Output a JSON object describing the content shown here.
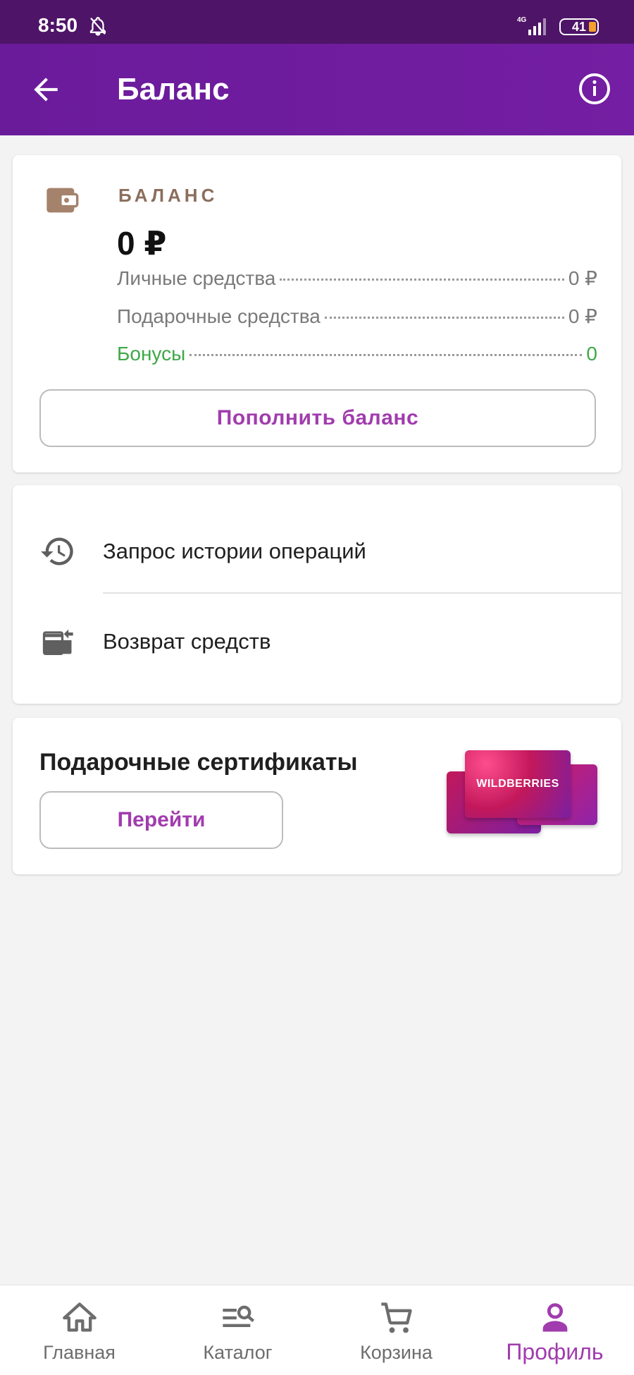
{
  "status_bar": {
    "time": "8:50",
    "network": "4G",
    "battery": "41",
    "icons": [
      "bell-off-icon",
      "signal-icon",
      "battery-icon"
    ]
  },
  "app_bar": {
    "title": "Баланс",
    "icons": [
      "arrow-back-icon",
      "info-icon"
    ]
  },
  "balance_card": {
    "label": "БАЛАНС",
    "amount": "0 ₽",
    "rows": [
      {
        "label": "Личные средства",
        "value": "0 ₽"
      },
      {
        "label": "Подарочные средства",
        "value": "0 ₽"
      },
      {
        "label": "Бонусы",
        "value": "0"
      }
    ],
    "topup_button": "Пополнить баланс",
    "icon": "wallet-icon"
  },
  "menu": {
    "items": [
      {
        "label": "Запрос истории операций",
        "icon": "history-icon"
      },
      {
        "label": "Возврат средств",
        "icon": "refund-card-icon"
      }
    ]
  },
  "gift_card": {
    "title": "Подарочные сертификаты",
    "button": "Перейти",
    "card_text": "WILDBERRIES"
  },
  "bottom_nav": {
    "items": [
      {
        "label": "Главная",
        "icon": "home-icon",
        "active": false
      },
      {
        "label": "Каталог",
        "icon": "catalog-search-icon",
        "active": false
      },
      {
        "label": "Корзина",
        "icon": "cart-icon",
        "active": false
      },
      {
        "label": "Профиль",
        "icon": "profile-icon",
        "active": true
      }
    ]
  },
  "colors": {
    "header": "#6a1b9a",
    "status_bar": "#4e1467",
    "accent": "#a13cae",
    "bonus_green": "#3fa848",
    "balance_label": "#8c6e5d"
  }
}
